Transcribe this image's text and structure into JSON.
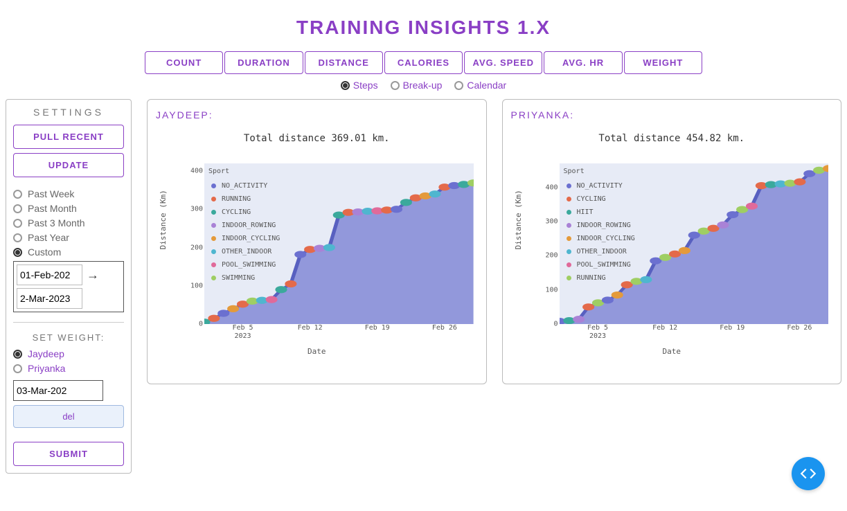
{
  "title": "TRAINING INSIGHTS 1.X",
  "tabs": [
    "COUNT",
    "DURATION",
    "DISTANCE",
    "CALORIES",
    "AVG. SPEED",
    "AVG. HR",
    "WEIGHT"
  ],
  "active_tab": 2,
  "view_modes": {
    "items": [
      "Steps",
      "Break-up",
      "Calendar"
    ],
    "selected": 0
  },
  "sidebar": {
    "heading": "SETTINGS",
    "pull_recent": "PULL RECENT",
    "update": "UPDATE",
    "range": {
      "items": [
        "Past Week",
        "Past Month",
        "Past 3 Month",
        "Past Year",
        "Custom"
      ],
      "selected": 4
    },
    "date_start": "01-Feb-202",
    "date_end": "2-Mar-2023",
    "weight": {
      "heading": "SET WEIGHT:",
      "people": [
        "Jaydeep",
        "Priyanka"
      ],
      "selected": 0,
      "date": "03-Mar-202",
      "del": "del",
      "submit": "SUBMIT"
    }
  },
  "panels": {
    "left": {
      "name": "JAYDEEP:",
      "total": "Total distance 369.01 km."
    },
    "right": {
      "name": "PRIYANKA:",
      "total": "Total distance 454.82 km."
    }
  },
  "chart_data": [
    {
      "type": "area",
      "title": "JAYDEEP cumulative distance",
      "xlabel": "Date",
      "ylabel": "Distance (Km)",
      "ylim": [
        0,
        420
      ],
      "y_ticks": [
        0,
        100,
        200,
        300,
        400
      ],
      "x_ticks": [
        "Feb 5\n2023",
        "Feb 12",
        "Feb 19",
        "Feb 26"
      ],
      "legend_title": "Sport",
      "legend": [
        {
          "name": "NO_ACTIVITY",
          "color": "#6b70d0"
        },
        {
          "name": "RUNNING",
          "color": "#e46a4a"
        },
        {
          "name": "CYCLING",
          "color": "#3ba99c"
        },
        {
          "name": "INDOOR_ROWING",
          "color": "#a982d6"
        },
        {
          "name": "INDOOR_CYCLING",
          "color": "#e49a3b"
        },
        {
          "name": "OTHER_INDOOR",
          "color": "#4fb6cf"
        },
        {
          "name": "POOL_SWIMMING",
          "color": "#e06a9a"
        },
        {
          "name": "SWIMMING",
          "color": "#9fce63"
        }
      ],
      "points": [
        {
          "day": 1,
          "val": 5,
          "sport": "CYCLING"
        },
        {
          "day": 2,
          "val": 15,
          "sport": "RUNNING"
        },
        {
          "day": 3,
          "val": 28,
          "sport": "NO_ACTIVITY"
        },
        {
          "day": 4,
          "val": 40,
          "sport": "INDOOR_CYCLING"
        },
        {
          "day": 5,
          "val": 52,
          "sport": "RUNNING"
        },
        {
          "day": 6,
          "val": 60,
          "sport": "SWIMMING"
        },
        {
          "day": 7,
          "val": 62,
          "sport": "OTHER_INDOOR"
        },
        {
          "day": 8,
          "val": 64,
          "sport": "POOL_SWIMMING"
        },
        {
          "day": 9,
          "val": 90,
          "sport": "CYCLING"
        },
        {
          "day": 10,
          "val": 105,
          "sport": "RUNNING"
        },
        {
          "day": 11,
          "val": 182,
          "sport": "NO_ACTIVITY"
        },
        {
          "day": 12,
          "val": 195,
          "sport": "RUNNING"
        },
        {
          "day": 13,
          "val": 198,
          "sport": "INDOOR_ROWING"
        },
        {
          "day": 14,
          "val": 200,
          "sport": "OTHER_INDOOR"
        },
        {
          "day": 15,
          "val": 285,
          "sport": "CYCLING"
        },
        {
          "day": 16,
          "val": 292,
          "sport": "RUNNING"
        },
        {
          "day": 17,
          "val": 293,
          "sport": "INDOOR_ROWING"
        },
        {
          "day": 18,
          "val": 295,
          "sport": "OTHER_INDOOR"
        },
        {
          "day": 19,
          "val": 296,
          "sport": "POOL_SWIMMING"
        },
        {
          "day": 20,
          "val": 298,
          "sport": "RUNNING"
        },
        {
          "day": 21,
          "val": 300,
          "sport": "NO_ACTIVITY"
        },
        {
          "day": 22,
          "val": 318,
          "sport": "CYCLING"
        },
        {
          "day": 23,
          "val": 330,
          "sport": "RUNNING"
        },
        {
          "day": 24,
          "val": 335,
          "sport": "INDOOR_CYCLING"
        },
        {
          "day": 25,
          "val": 340,
          "sport": "OTHER_INDOOR"
        },
        {
          "day": 26,
          "val": 358,
          "sport": "RUNNING"
        },
        {
          "day": 27,
          "val": 362,
          "sport": "NO_ACTIVITY"
        },
        {
          "day": 28,
          "val": 365,
          "sport": "CYCLING"
        },
        {
          "day": 29,
          "val": 369,
          "sport": "SWIMMING"
        }
      ]
    },
    {
      "type": "area",
      "title": "PRIYANKA cumulative distance",
      "xlabel": "Date",
      "ylabel": "Distance (Km)",
      "ylim": [
        0,
        470
      ],
      "y_ticks": [
        0,
        100,
        200,
        300,
        400
      ],
      "x_ticks": [
        "Feb 5\n2023",
        "Feb 12",
        "Feb 19",
        "Feb 26"
      ],
      "legend_title": "Sport",
      "legend": [
        {
          "name": "NO_ACTIVITY",
          "color": "#6b70d0"
        },
        {
          "name": "CYCLING",
          "color": "#e46a4a"
        },
        {
          "name": "HIIT",
          "color": "#3ba99c"
        },
        {
          "name": "INDOOR_ROWING",
          "color": "#a982d6"
        },
        {
          "name": "INDOOR_CYCLING",
          "color": "#e49a3b"
        },
        {
          "name": "OTHER_INDOOR",
          "color": "#4fb6cf"
        },
        {
          "name": "POOL_SWIMMING",
          "color": "#e06a9a"
        },
        {
          "name": "RUNNING",
          "color": "#9fce63"
        }
      ],
      "points": [
        {
          "day": 1,
          "val": 8,
          "sport": "NO_ACTIVITY"
        },
        {
          "day": 2,
          "val": 10,
          "sport": "HIIT"
        },
        {
          "day": 3,
          "val": 14,
          "sport": "INDOOR_ROWING"
        },
        {
          "day": 4,
          "val": 50,
          "sport": "CYCLING"
        },
        {
          "day": 5,
          "val": 62,
          "sport": "RUNNING"
        },
        {
          "day": 6,
          "val": 70,
          "sport": "NO_ACTIVITY"
        },
        {
          "day": 7,
          "val": 85,
          "sport": "INDOOR_CYCLING"
        },
        {
          "day": 8,
          "val": 115,
          "sport": "CYCLING"
        },
        {
          "day": 9,
          "val": 125,
          "sport": "RUNNING"
        },
        {
          "day": 10,
          "val": 130,
          "sport": "OTHER_INDOOR"
        },
        {
          "day": 11,
          "val": 185,
          "sport": "NO_ACTIVITY"
        },
        {
          "day": 12,
          "val": 195,
          "sport": "RUNNING"
        },
        {
          "day": 13,
          "val": 205,
          "sport": "CYCLING"
        },
        {
          "day": 14,
          "val": 215,
          "sport": "INDOOR_CYCLING"
        },
        {
          "day": 15,
          "val": 260,
          "sport": "NO_ACTIVITY"
        },
        {
          "day": 16,
          "val": 272,
          "sport": "RUNNING"
        },
        {
          "day": 17,
          "val": 280,
          "sport": "CYCLING"
        },
        {
          "day": 18,
          "val": 290,
          "sport": "INDOOR_ROWING"
        },
        {
          "day": 19,
          "val": 320,
          "sport": "NO_ACTIVITY"
        },
        {
          "day": 20,
          "val": 335,
          "sport": "RUNNING"
        },
        {
          "day": 21,
          "val": 345,
          "sport": "POOL_SWIMMING"
        },
        {
          "day": 22,
          "val": 405,
          "sport": "CYCLING"
        },
        {
          "day": 23,
          "val": 408,
          "sport": "HIIT"
        },
        {
          "day": 24,
          "val": 410,
          "sport": "OTHER_INDOOR"
        },
        {
          "day": 25,
          "val": 412,
          "sport": "RUNNING"
        },
        {
          "day": 26,
          "val": 416,
          "sport": "CYCLING"
        },
        {
          "day": 27,
          "val": 440,
          "sport": "NO_ACTIVITY"
        },
        {
          "day": 28,
          "val": 450,
          "sport": "RUNNING"
        },
        {
          "day": 29,
          "val": 455,
          "sport": "INDOOR_CYCLING"
        }
      ]
    }
  ]
}
